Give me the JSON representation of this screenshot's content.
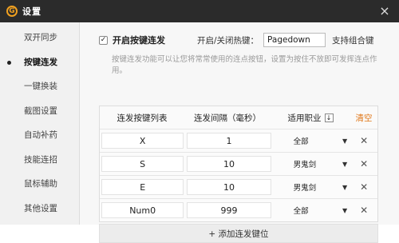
{
  "window": {
    "title": "设置",
    "close_icon": "×",
    "logo_glyph": "G"
  },
  "sidebar": {
    "items": [
      {
        "label": "双开同步"
      },
      {
        "label": "按键连发"
      },
      {
        "label": "一键换装"
      },
      {
        "label": "截图设置"
      },
      {
        "label": "自动补药"
      },
      {
        "label": "技能连招"
      },
      {
        "label": "鼠标辅助"
      },
      {
        "label": "其他设置"
      }
    ],
    "active_index": 1
  },
  "settings": {
    "enable_checked": true,
    "enable_label": "开启按键连发",
    "hotkey_label": "开启/关闭热键：",
    "hotkey_value": "Pagedown",
    "combo_label": "支持组合键",
    "description": "按键连发功能可以让您将常常使用的连点按钮，设置为按住不放即可发挥连点作用。"
  },
  "table": {
    "headers": {
      "key": "连发按键列表",
      "interval": "连发间隔（毫秒）",
      "job": "适用职业",
      "clear": "清空"
    },
    "rows": [
      {
        "key": "X",
        "interval": "1",
        "job": "全部"
      },
      {
        "key": "S",
        "interval": "10",
        "job": "男鬼剑"
      },
      {
        "key": "E",
        "interval": "10",
        "job": "男鬼剑"
      },
      {
        "key": "Num0",
        "interval": "999",
        "job": "全部"
      }
    ]
  },
  "add_button": {
    "label": "+ 添加连发键位"
  }
}
